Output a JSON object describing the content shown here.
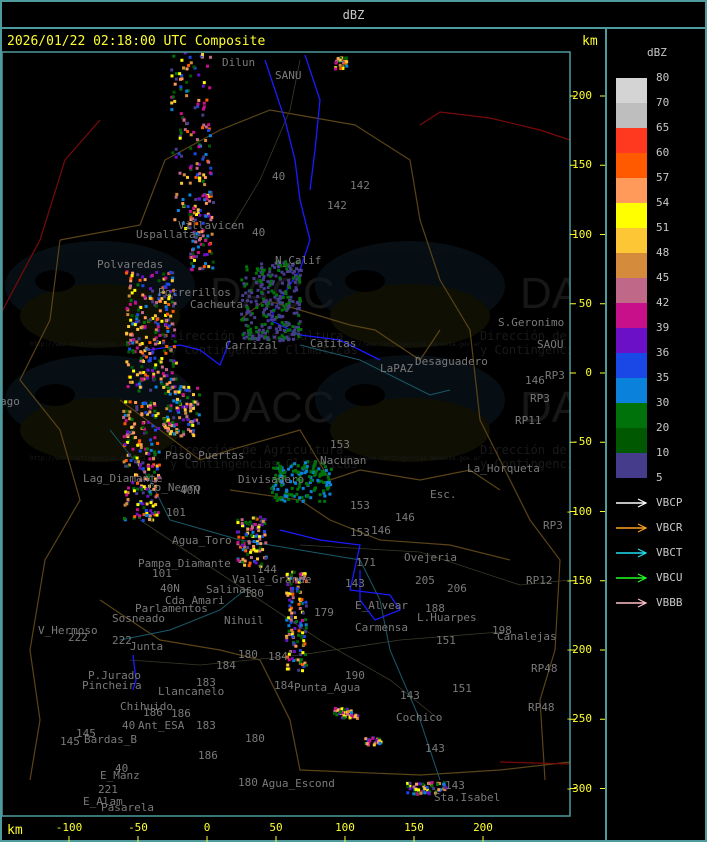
{
  "header": {
    "title": "dBZ"
  },
  "map": {
    "title": "2026/01/22 02:18:00 UTC Composite",
    "unit_y": "km",
    "unit_x": "km",
    "y_ticks": [
      200,
      150,
      100,
      50,
      0,
      -50,
      -100,
      -150,
      -200,
      -250,
      -300
    ],
    "x_ticks": [
      -100,
      -50,
      0,
      50,
      100,
      150,
      200
    ],
    "colors": {
      "border_province": "#5a4418",
      "border_country": "#7a0a0a",
      "river": "#1a5a6a",
      "lake": "#1a1aff",
      "roads": "#3a3a2a",
      "labels": "#7a7a7a",
      "axis": "#ffff30",
      "frame": "#4f9a9c"
    },
    "watermark": {
      "logo_text": "DACC",
      "line1": "Dirección de Agricultura",
      "line2": "y Contingencias Climáticas",
      "url": "http://www.contingencias.mendoza.gov.ar"
    },
    "places": [
      "Dilun",
      "SANU",
      "40",
      "142",
      "142",
      "40",
      "Villavicen",
      "Uspallata",
      "Polvaredas",
      "N_Calif",
      "Potrerillos",
      "Cacheuta",
      "Carrizal",
      "Catitas",
      "S.Geronimo",
      "SAOU",
      "Desaguadero",
      "LaPAZ",
      "146",
      "RP3",
      "RP3",
      "RP11",
      "ago",
      "153",
      "Nacunan",
      "La_Horqueta",
      "Esc.",
      "Divisadero",
      "Lag_Diamante",
      "Co_Negro",
      "Paso_Puertas",
      "40N",
      "101",
      "146",
      "146",
      "153",
      "153",
      "RP3",
      "Agua_Toro",
      "Pampa_Diamante",
      "101",
      "40N",
      "Salinas",
      "180",
      "Cda_Amari",
      "Parlamentos",
      "Sosneado",
      "Nihuil",
      "V_Hermoso",
      "222",
      "222",
      "Junta",
      "P.Jurado",
      "Pincheira",
      "184",
      "184",
      "180",
      "184",
      "Llancanelo",
      "Chihuido",
      "186",
      "186",
      "183",
      "183",
      "Ant_ESA",
      "40",
      "145",
      "145",
      "Bardas_B",
      "180",
      "186",
      "40",
      "E_Manz",
      "221",
      "E_Alam",
      "Pasarela",
      "180",
      "Agua_Escond",
      "179",
      "190",
      "Punta_Agua",
      "143",
      "Cochico",
      "143",
      "143",
      "Sta.Isabel",
      "Valle_Grande",
      "144",
      "171",
      "143",
      "205",
      "206",
      "Ovejeria",
      "188",
      "L.Huarpes",
      "151",
      "151",
      "Carmensa",
      "E_Alvear",
      "198",
      "Canalejas",
      "RP12",
      "RP48",
      "RP48"
    ]
  },
  "legend": {
    "title": "dBZ",
    "labels": [
      "80",
      "70",
      "65",
      "60",
      "57",
      "54",
      "51",
      "48",
      "45",
      "42",
      "39",
      "36",
      "35",
      "30",
      "20",
      "10",
      "5"
    ],
    "colors": [
      "#d4d4d4",
      "#bebebe",
      "#ff3820",
      "#ff5a00",
      "#ff9a5a",
      "#ffff00",
      "#fcc634",
      "#d48c3c",
      "#c06888",
      "#c8108a",
      "#6c10c8",
      "#1a48e6",
      "#0a82dc",
      "#00720a",
      "#005800",
      "#463c8c"
    ],
    "radars": [
      {
        "name": "VBCP",
        "color": "#ffffff"
      },
      {
        "name": "VBCR",
        "color": "#ffa020"
      },
      {
        "name": "VBCT",
        "color": "#20e0f0"
      },
      {
        "name": "VBCU",
        "color": "#20ff20"
      },
      {
        "name": "VBBB",
        "color": "#ffc0c8"
      }
    ]
  }
}
